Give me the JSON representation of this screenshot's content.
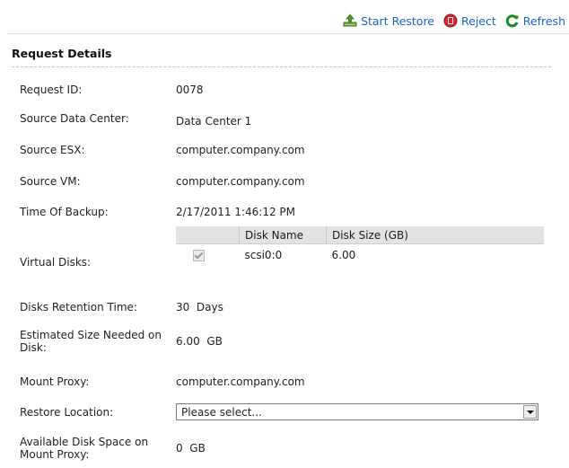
{
  "toolbar": {
    "start_restore": "Start Restore",
    "reject": "Reject",
    "refresh": "Refresh"
  },
  "section": {
    "title": "Request Details"
  },
  "fields": {
    "request_id": {
      "label": "Request ID:",
      "value": "0078"
    },
    "source_dc": {
      "label": "Source Data Center:",
      "value": "Data Center 1"
    },
    "source_esx": {
      "label": "Source ESX:",
      "value": "computer.company.com"
    },
    "source_vm": {
      "label": "Source VM:",
      "value": "computer.company.com"
    },
    "time_of_backup": {
      "label": "Time Of Backup:",
      "value": "2/17/2011 1:46:12 PM"
    },
    "virtual_disks": {
      "label": "Virtual Disks:",
      "columns": [
        "",
        "Disk Name",
        "Disk Size (GB)"
      ],
      "rows": [
        {
          "checked": true,
          "name": "scsi0:0",
          "size": "6.00"
        }
      ]
    },
    "retention": {
      "label": "Disks Retention Time:",
      "value": "30",
      "unit": "Days"
    },
    "est_size": {
      "label_1": "Estimated Size Needed on",
      "label_2": "Disk:",
      "value": "6.00",
      "unit": "GB"
    },
    "mount_proxy": {
      "label": "Mount Proxy:",
      "value": "computer.company.com"
    },
    "restore_location": {
      "label": "Restore Location:",
      "selected": "Please select..."
    },
    "avail_space": {
      "label_1": "Available Disk Space on",
      "label_2": "Mount Proxy:",
      "value": "0",
      "unit": "GB"
    }
  },
  "colors": {
    "link": "#1a63c8",
    "header_bg": "#e3e3e3",
    "reject_icon": "#d9232e",
    "refresh_icon": "#1f8a2a"
  }
}
